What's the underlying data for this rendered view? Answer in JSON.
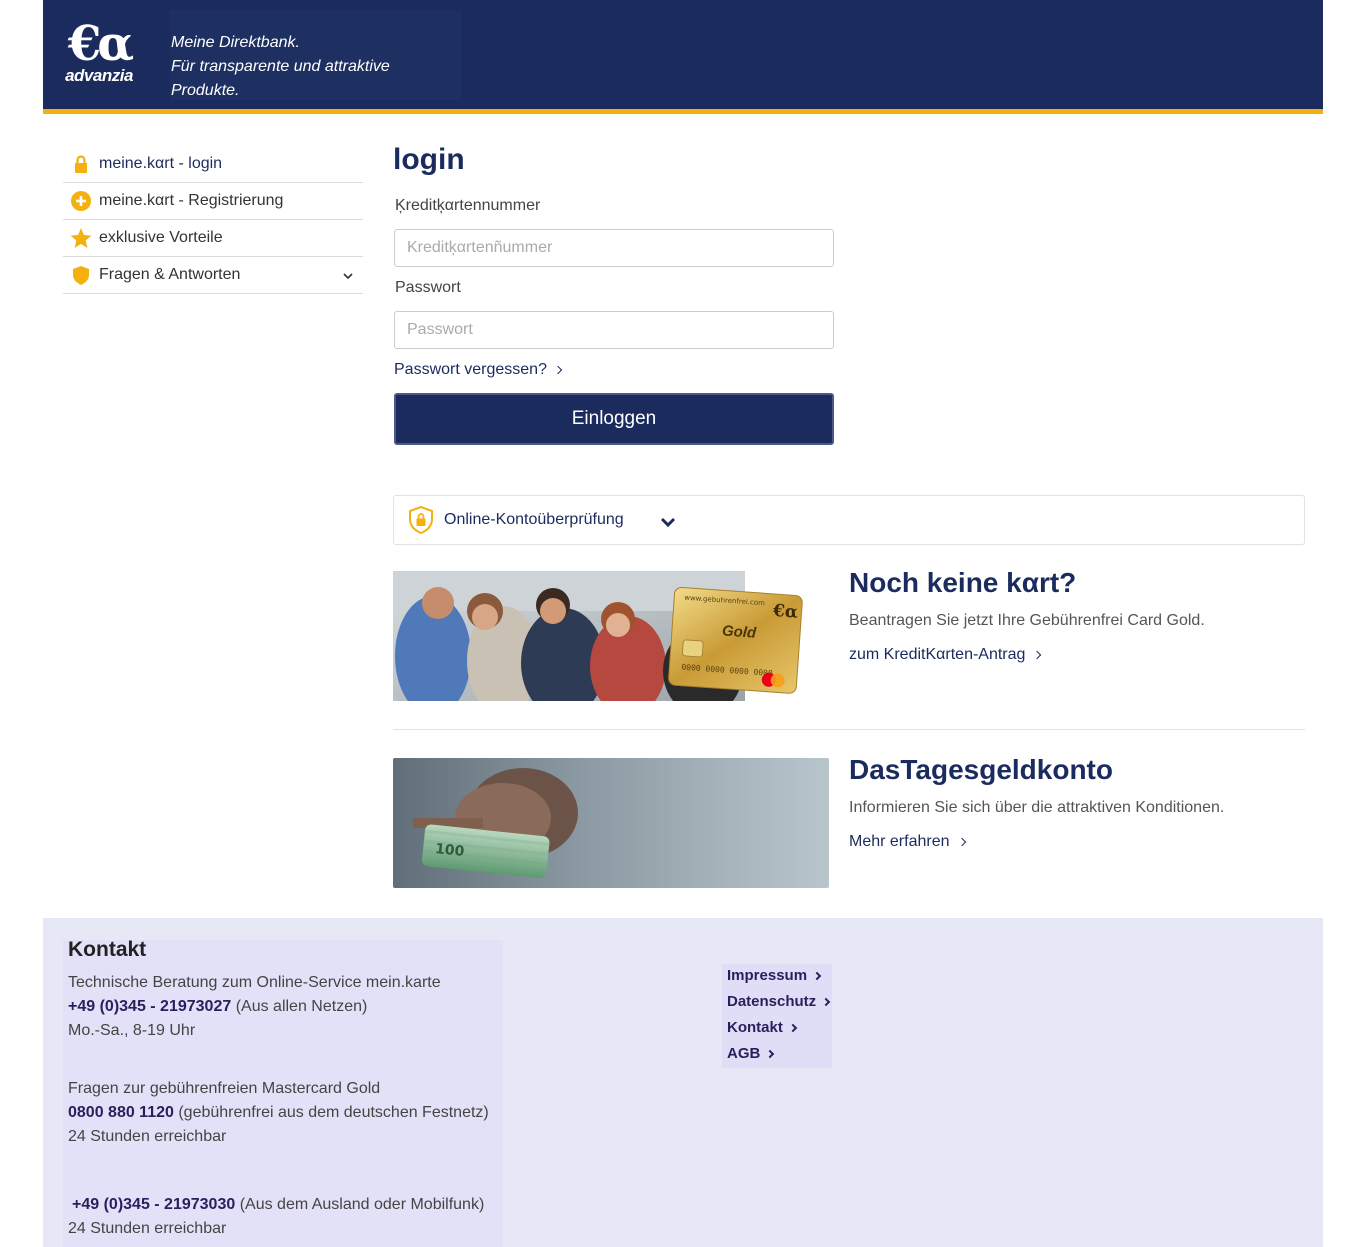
{
  "header": {
    "logo_text": "advanzia",
    "slogan_line1": "Meine Direktbank.",
    "slogan_line2": "Für transparente und attraktive Produkte.",
    "brand_color": "#1b2b5e",
    "accent_color": "#f3b00f"
  },
  "sidebar": {
    "items": [
      {
        "label": "meine.kαrt - login",
        "icon": "lock-icon"
      },
      {
        "label": "meine.kαrt - Registrierung",
        "icon": "plus-circle-icon"
      },
      {
        "label": "exklusive Vorteile",
        "icon": "star-icon"
      },
      {
        "label": "Fragen & Antworten",
        "icon": "shield-icon"
      }
    ]
  },
  "login": {
    "title": "login",
    "card_label": "Ķreditķαrtennummer",
    "card_placeholder": "Kreditķαrtenñummer",
    "password_label": "Passwort",
    "password_placeholder": "Passwort",
    "forgot_label": "Passwort vergessen?",
    "submit_label": "Einloggen"
  },
  "online_check": {
    "label": "Online-Kontoüberprüfung"
  },
  "promo1": {
    "title": "Noch keine kαrt?",
    "text": "Beantragen Sie jetzt Ihre Gebührenfrei Card Gold.",
    "link": "zum KreditKαrten-Antrag",
    "card_gold": "Gold",
    "card_number": "0000 0000 0000 0000",
    "card_url": "www.gebuhrenfrei.com"
  },
  "promo2": {
    "title": "DasTagesgeldkonto",
    "text": "Informieren Sie sich über die attraktiven Konditionen.",
    "link": "Mehr erfahren"
  },
  "footer": {
    "contact_title": "Kontakt",
    "service_text": "Technische Beratung zum Online-Service mein.karte",
    "phone1": "+49 (0)345 - 21973027",
    "phone1_note": "(Aus allen Netzen)",
    "hours1": "Mo.-Sa., 8-19 Uhr",
    "gold_text": "Fragen zur gebührenfreien Mastercard Gold",
    "phone2": "0800 880 1120",
    "phone2_note": "(gebührenfrei aus dem deutschen Festnetz)",
    "hours2": "24 Stunden erreichbar",
    "phone3": "+49 (0)345 - 21973030",
    "phone3_note": "(Aus dem Ausland oder Mobilfunk)",
    "hours3": "24 Stunden erreichbar",
    "links": [
      "Impressum",
      "Datenschutz",
      "Kontakt",
      "AGB"
    ]
  }
}
